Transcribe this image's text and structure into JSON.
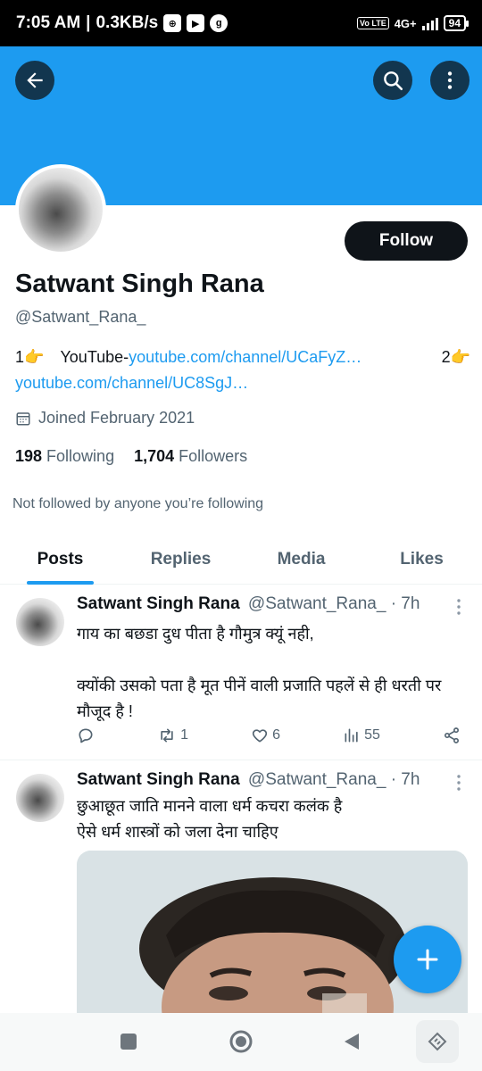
{
  "status_bar": {
    "time": "7:05 AM",
    "net_speed": "0.3KB/s",
    "volte": "Vo LTE",
    "network": "4G+",
    "battery": "94"
  },
  "header": {
    "back_icon": "arrow-left-icon",
    "search_icon": "search-icon",
    "more_icon": "more-vertical-icon",
    "banner_color": "#1d9bf0"
  },
  "profile": {
    "follow_label": "Follow",
    "name": "Satwant Singh Rana",
    "handle": "@Satwant_Rana_",
    "bio": {
      "item1_num": "1👉",
      "item1_label": "YouTube-",
      "item1_link": "youtube.com/channel/UCaFyZ…",
      "item2_num": "2👉",
      "item2_link": "youtube.com/channel/UC8SgJ…"
    },
    "joined": "Joined February 2021",
    "following_count": "198",
    "following_label": "Following",
    "followers_count": "1,704",
    "followers_label": "Followers",
    "not_followed": "Not followed by anyone you’re following"
  },
  "tabs": [
    {
      "label": "Posts",
      "active": true
    },
    {
      "label": "Replies",
      "active": false
    },
    {
      "label": "Media",
      "active": false
    },
    {
      "label": "Likes",
      "active": false
    }
  ],
  "tweets": [
    {
      "name": "Satwant Singh Rana",
      "handle": "@Satwant_Rana_ · 7h",
      "text": "गाय का बछडा दुध पीता है गौमुत्र क्यूं नही,\n\n क्योंकी उसको पता है मूत पीनें वाली प्रजाति पहलें से ही धरती पर मौजूद है !",
      "retweets": "1",
      "likes": "6",
      "views": "55"
    },
    {
      "name": "Satwant Singh Rana",
      "handle": "@Satwant_Rana_ · 7h",
      "text": "छुआछूत जाति मानने वाला धर्म कचरा कलंक है\nऐसे धर्म शास्त्रों को जला देना चाहिए"
    }
  ],
  "accent_color": "#1d9bf0"
}
